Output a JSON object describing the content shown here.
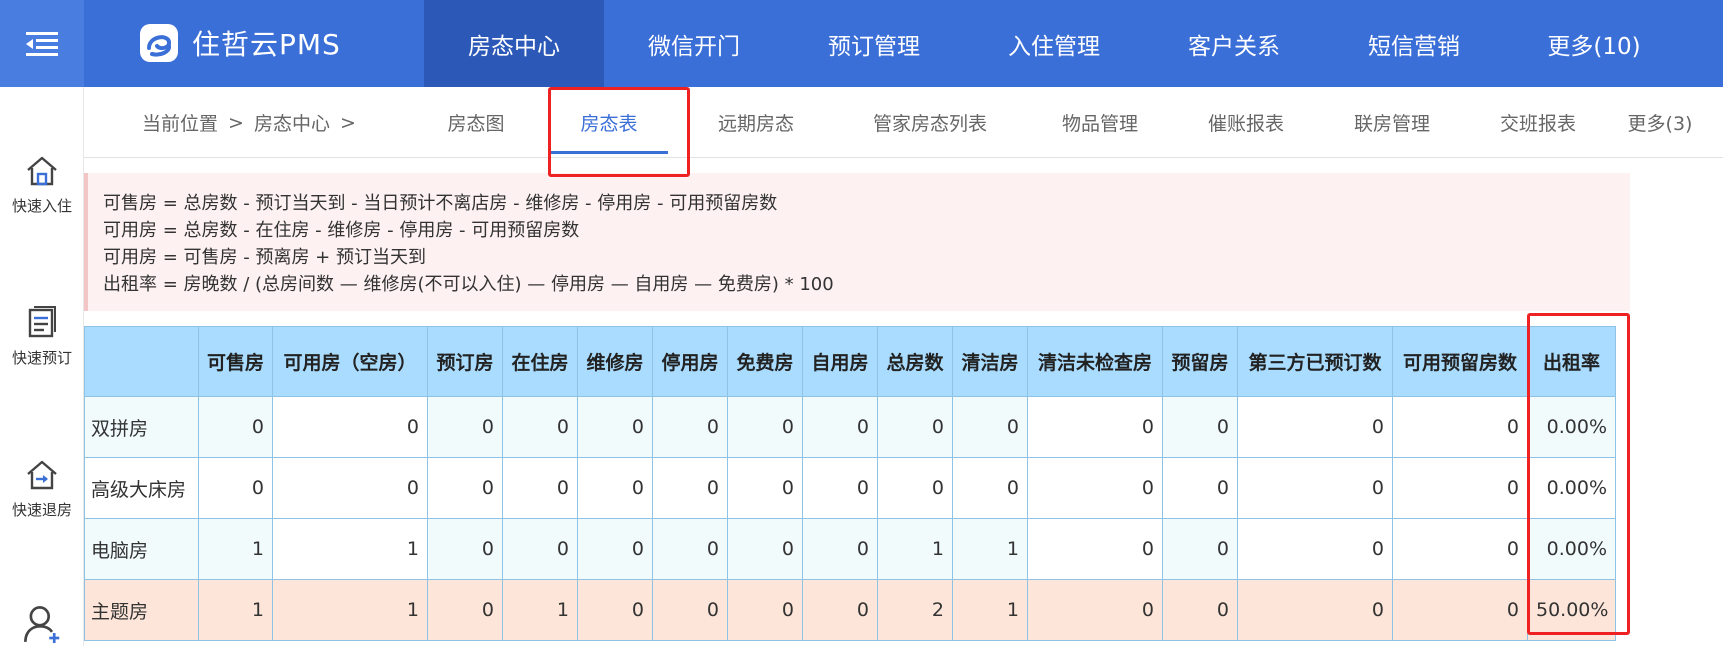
{
  "header": {
    "logo_text": "住哲云PMS",
    "nav": [
      {
        "label": "房态中心",
        "active": true
      },
      {
        "label": "微信开门",
        "active": false
      },
      {
        "label": "预订管理",
        "active": false
      },
      {
        "label": "入住管理",
        "active": false
      },
      {
        "label": "客户关系",
        "active": false
      },
      {
        "label": "短信营销",
        "active": false
      },
      {
        "label": "更多(10)",
        "active": false
      }
    ]
  },
  "sidebar": {
    "items": [
      {
        "label": "快速入住",
        "icon": "house-icon"
      },
      {
        "label": "快速预订",
        "icon": "document-icon"
      },
      {
        "label": "快速退房",
        "icon": "checkout-house-icon"
      },
      {
        "label": "",
        "icon": "add-user-icon"
      }
    ]
  },
  "breadcrumb": {
    "prefix": "当前位置",
    "sep1": ">",
    "current": "房态中心",
    "sep2": ">"
  },
  "subnav": {
    "tabs": [
      {
        "label": "房态图",
        "active": false
      },
      {
        "label": "房态表",
        "active": true
      },
      {
        "label": "远期房态",
        "active": false
      },
      {
        "label": "管家房态列表",
        "active": false
      },
      {
        "label": "物品管理",
        "active": false
      },
      {
        "label": "催账报表",
        "active": false
      },
      {
        "label": "联房管理",
        "active": false
      },
      {
        "label": "交班报表",
        "active": false
      },
      {
        "label": "更多(3)",
        "active": false
      }
    ]
  },
  "formulas": [
    "可售房 = 总房数 - 预订当天到 - 当日预计不离店房 - 维修房 - 停用房 - 可用预留房数",
    "可用房 = 总房数 - 在住房 - 维修房 - 停用房 - 可用预留房数",
    "可用房 = 可售房 - 预离房 + 预订当天到",
    "出租率 = 房晚数 / (总房间数 — 维修房(不可以入住) — 停用房 — 自用房 — 免费房) * 100"
  ],
  "table": {
    "columns": [
      "",
      "可售房",
      "可用房（空房）",
      "预订房",
      "在住房",
      "维修房",
      "停用房",
      "免费房",
      "自用房",
      "总房数",
      "清洁房",
      "清洁未检查房",
      "预留房",
      "第三方已预订数",
      "可用预留房数",
      "出租率"
    ],
    "rows": [
      {
        "name": "双拼房",
        "cells": [
          "0",
          "0",
          "0",
          "0",
          "0",
          "0",
          "0",
          "0",
          "0",
          "0",
          "0",
          "0",
          "0",
          "0",
          "0.00%"
        ]
      },
      {
        "name": "高级大床房",
        "cells": [
          "0",
          "0",
          "0",
          "0",
          "0",
          "0",
          "0",
          "0",
          "0",
          "0",
          "0",
          "0",
          "0",
          "0",
          "0.00%"
        ]
      },
      {
        "name": "电脑房",
        "cells": [
          "1",
          "1",
          "0",
          "0",
          "0",
          "0",
          "0",
          "0",
          "1",
          "1",
          "0",
          "0",
          "0",
          "0",
          "0.00%"
        ]
      },
      {
        "name": "主题房",
        "cells": [
          "1",
          "1",
          "0",
          "1",
          "0",
          "0",
          "0",
          "0",
          "2",
          "1",
          "0",
          "0",
          "0",
          "0",
          "50.00%"
        ]
      }
    ]
  },
  "colors": {
    "brand_blue": "#3b6fd8",
    "active_nav": "#2c59b7",
    "header_cell": "#a9dcff",
    "highlight_row": "#fde6d9",
    "annotation_red": "#ee2222"
  }
}
